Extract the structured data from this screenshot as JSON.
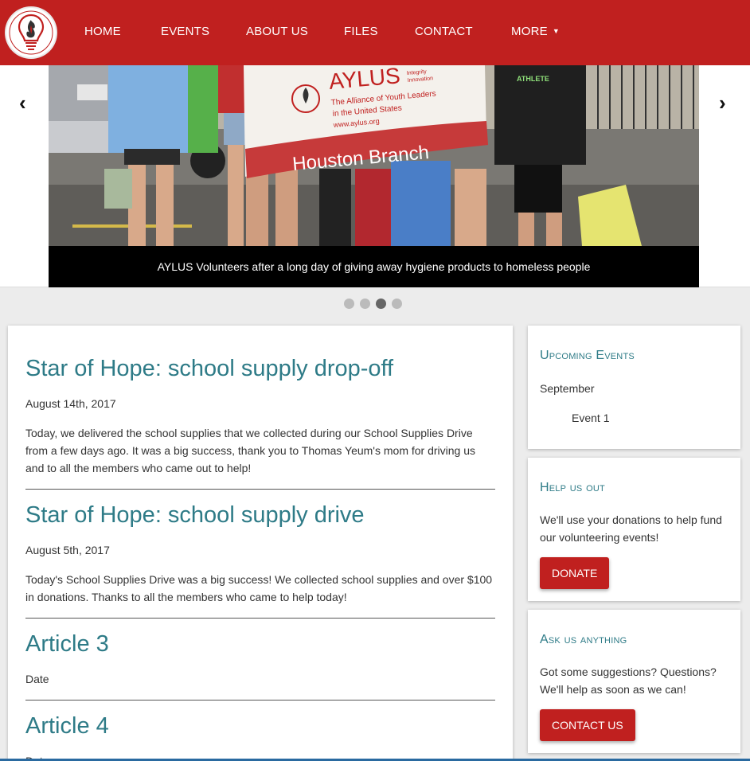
{
  "nav": {
    "items": [
      {
        "label": "HOME"
      },
      {
        "label": "EVENTS"
      },
      {
        "label": "ABOUT US"
      },
      {
        "label": "FILES"
      },
      {
        "label": "CONTACT"
      },
      {
        "label": "MORE"
      }
    ],
    "more_caret": "▼"
  },
  "carousel": {
    "prev": "‹",
    "next": "›",
    "caption": "AYLUS Volunteers after a long day of giving away hygiene products to homeless people",
    "banner": {
      "org": "AYLUS",
      "tagline_1": "The Alliance of Youth Leaders",
      "tagline_2": "in the United States",
      "url": "www.aylus.org",
      "small_1": "Integrity",
      "small_2": "Innovation",
      "branch": "Houston Branch"
    },
    "shirt_text": "ATHLETE",
    "slide_count": 4,
    "active_index": 2
  },
  "articles": [
    {
      "title": "Star of Hope: school supply drop-off",
      "date": "August 14th, 2017",
      "body": "Today, we delivered the school supplies that we collected during our School Supplies Drive from a few days ago. It was a big success, thank you to Thomas Yeum's mom for driving us and to all the members who came out to help!"
    },
    {
      "title": "Star of Hope: school supply drive",
      "date": "August 5th, 2017",
      "body": "Today's School Supplies Drive was a big success! We collected school supplies and over $100 in donations. Thanks to all the members who came to help today!"
    },
    {
      "title": "Article 3",
      "date": "Date"
    },
    {
      "title": "Article 4",
      "date": "Date"
    }
  ],
  "sidebar": {
    "events": {
      "title": "Upcoming Events",
      "month": "September",
      "event": "Event 1"
    },
    "help": {
      "title": "Help us out",
      "text": "We'll use your donations to help fund our volunteering events!",
      "button": "DONATE"
    },
    "ask": {
      "title": "Ask us anything",
      "text": "Got some suggestions? Questions? We'll help as soon as we can!",
      "button": "CONTACT US"
    }
  },
  "colors": {
    "brand_red": "#c0201f",
    "accent_teal": "#2e7b87"
  }
}
